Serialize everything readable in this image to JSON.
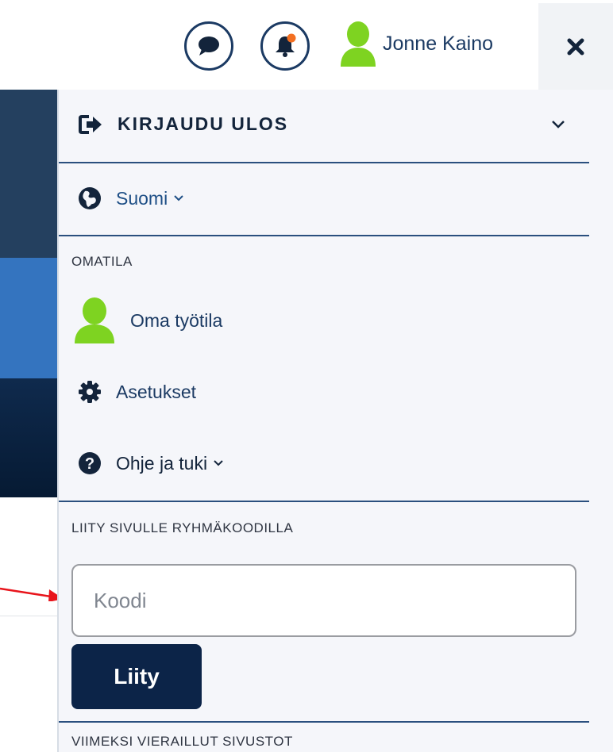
{
  "header": {
    "messages_icon": "chat-bubble-icon",
    "notifications_icon": "bell-icon",
    "notification_dot_color": "#f36f21",
    "user_name": "Jonne Kaino",
    "avatar_color": "#7ed321",
    "close_icon": "close-x-icon"
  },
  "menu": {
    "logout_label": "KIRJAUDU ULOS",
    "language_label": "Suomi",
    "omatila_title": "OMATILA",
    "omatila_items": [
      {
        "label": "Oma työtila",
        "icon": "user-avatar-icon"
      },
      {
        "label": "Asetukset",
        "icon": "gear-icon"
      },
      {
        "label": "Ohje ja tuki",
        "icon": "help-icon"
      }
    ],
    "join_title": "LIITY SIVULLE RYHMÄKOODILLA",
    "code_placeholder": "Koodi",
    "join_button": "Liity",
    "recent_title": "VIIMEKSI VIERAILLUT SIVUSTOT"
  },
  "colors": {
    "accent": "#1b3a63",
    "divider": "#2a4f7e",
    "join_button_bg": "#0c2448",
    "arrow": "#e8141b"
  }
}
